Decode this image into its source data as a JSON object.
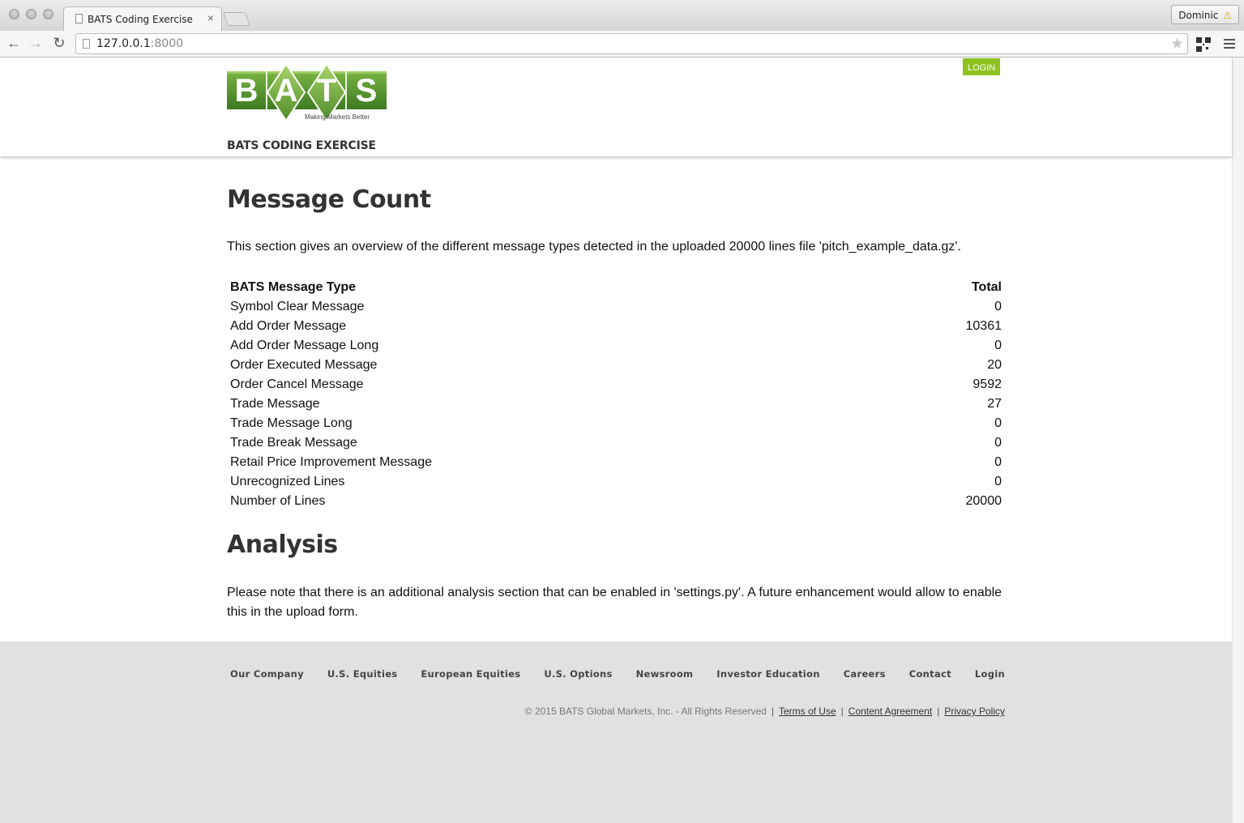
{
  "browser": {
    "tab_title": "BATS Coding Exercise",
    "tab_close": "×",
    "profile_name": "Dominic",
    "url_host": "127.0.0.1",
    "url_port": ":8000"
  },
  "header": {
    "logo_text": "BATS",
    "logo_letters": [
      "B",
      "A",
      "T",
      "S"
    ],
    "logo_tagline": "Making Markets Better",
    "login_label": "LOGIN",
    "subtitle": "BATS CODING EXERCISE"
  },
  "message_count": {
    "heading": "Message Count",
    "intro": "This section gives an overview of the different message types detected in the uploaded 20000 lines file 'pitch_example_data.gz'.",
    "table": {
      "col_type": "BATS Message Type",
      "col_total": "Total",
      "rows": [
        {
          "type": "Symbol Clear Message",
          "total": "0"
        },
        {
          "type": "Add Order Message",
          "total": "10361"
        },
        {
          "type": "Add Order Message Long",
          "total": "0"
        },
        {
          "type": "Order Executed Message",
          "total": "20"
        },
        {
          "type": "Order Cancel Message",
          "total": "9592"
        },
        {
          "type": "Trade Message",
          "total": "27"
        },
        {
          "type": "Trade Message Long",
          "total": "0"
        },
        {
          "type": "Trade Break Message",
          "total": "0"
        },
        {
          "type": "Retail Price Improvement Message",
          "total": "0"
        },
        {
          "type": "Unrecognized Lines",
          "total": "0"
        },
        {
          "type": "Number of Lines",
          "total": "20000"
        }
      ]
    }
  },
  "analysis": {
    "heading": "Analysis",
    "text": "Please note that there is an additional analysis section that can be enabled in 'settings.py'. A future enhancement would allow to enable this in the upload form."
  },
  "footer": {
    "nav": [
      "Our Company",
      "U.S. Equities",
      "European Equities",
      "U.S. Options",
      "Newsroom",
      "Investor Education",
      "Careers",
      "Contact",
      "Login"
    ],
    "copyright": "© 2015 BATS Global Markets, Inc. - All Rights Reserved",
    "separator": "|",
    "links": {
      "terms": "Terms of Use",
      "content": "Content Agreement",
      "privacy": "Privacy Policy"
    }
  },
  "colors": {
    "brand_green": "#5a9a2a",
    "login_green": "#8dc21f",
    "footer_bg": "#e1e1e1"
  },
  "icons": [
    "back-arrow-icon",
    "forward-arrow-icon",
    "reload-icon",
    "page-icon",
    "bookmark-star-icon",
    "qr-code-icon",
    "menu-icon",
    "warning-icon"
  ]
}
